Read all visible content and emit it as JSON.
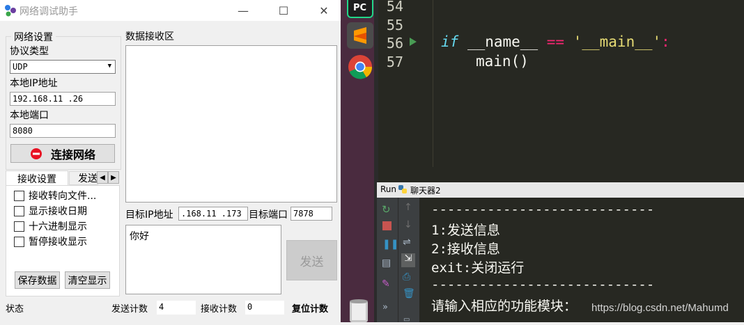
{
  "window": {
    "title": "网络调试助手",
    "minimize": "—",
    "maximize": "☐",
    "close": "✕"
  },
  "network_settings": {
    "group_title": "网络设置",
    "protocol_label": "协议类型",
    "protocol_value": "UDP",
    "local_ip_label": "本地IP地址",
    "local_ip_value": "192.168.11 .26",
    "local_port_label": "本地端口",
    "local_port_value": "8080",
    "connect_button": "连接网络"
  },
  "receive_area": {
    "title": "数据接收区"
  },
  "tabs": {
    "receive": "接收设置",
    "send": "发送"
  },
  "receive_options": [
    {
      "label": "接收转向文件...",
      "checked": false
    },
    {
      "label": "显示接收日期",
      "checked": false
    },
    {
      "label": "十六进制显示",
      "checked": false
    },
    {
      "label": "暂停接收显示",
      "checked": false
    }
  ],
  "buttons": {
    "save": "保存数据",
    "clear": "清空显示",
    "send": "发送"
  },
  "target": {
    "ip_label": "目标IP地址",
    "ip_value": ".168.11 .173",
    "port_label": "目标端口",
    "port_value": "7878"
  },
  "send_text": "你好",
  "statusbar": {
    "state_label": "状态",
    "send_count_label": "发送计数",
    "send_count": "4",
    "recv_count_label": "接收计数",
    "recv_count": "0",
    "reset_label": "复位计数"
  },
  "ide": {
    "toolbar_apps": [
      "pycharm-icon",
      "sublime-icon",
      "chrome-icon",
      "recycle-bin-icon"
    ],
    "line_numbers": [
      "54",
      "55",
      "56",
      "57"
    ],
    "code": {
      "line56_kw": "if",
      "line56_name": "__name__",
      "line56_op": "==",
      "line56_str": "'__main__'",
      "line56_colon": ":",
      "line57": "main()"
    },
    "run_tab": {
      "label": "Run",
      "config": "聊天器2"
    },
    "console_lines": [
      "----------------------------",
      "1:发送信息",
      "2:接收信息",
      "exit:关闭运行",
      "----------------------------",
      "请输入相应的功能模块："
    ],
    "watermark": "https://blog.csdn.net/Mahumd"
  },
  "colors": {
    "keyword": "#66d9ef",
    "operator": "#f92672",
    "string": "#e6db74",
    "editor_bg": "#272822",
    "dock_bg": "#4a2b3f",
    "connect_icon": "#e81123"
  }
}
